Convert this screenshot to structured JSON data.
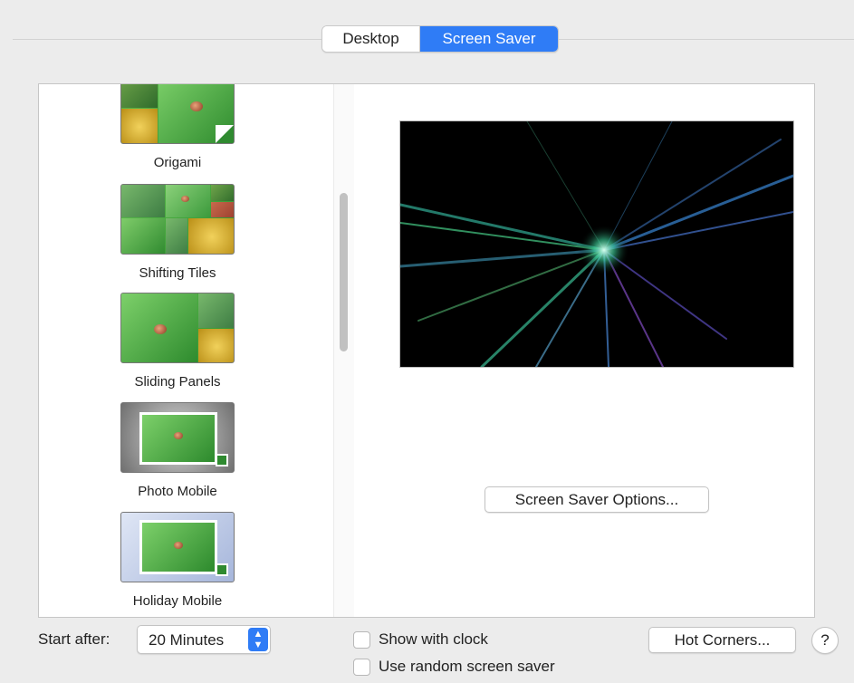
{
  "tabs": [
    {
      "label": "Desktop",
      "active": false
    },
    {
      "label": "Screen Saver",
      "active": true
    }
  ],
  "savers": [
    {
      "label": "Origami"
    },
    {
      "label": "Shifting Tiles"
    },
    {
      "label": "Sliding Panels"
    },
    {
      "label": "Photo Mobile"
    },
    {
      "label": "Holiday Mobile"
    }
  ],
  "options_button": "Screen Saver Options...",
  "start_after": {
    "label": "Start after:",
    "value": "20 Minutes"
  },
  "checkboxes": {
    "show_clock": "Show with clock",
    "random": "Use random screen saver"
  },
  "hot_corners_button": "Hot Corners...",
  "help_button": "?",
  "colors": {
    "accent": "#2f7cf6",
    "background": "#ececec"
  }
}
